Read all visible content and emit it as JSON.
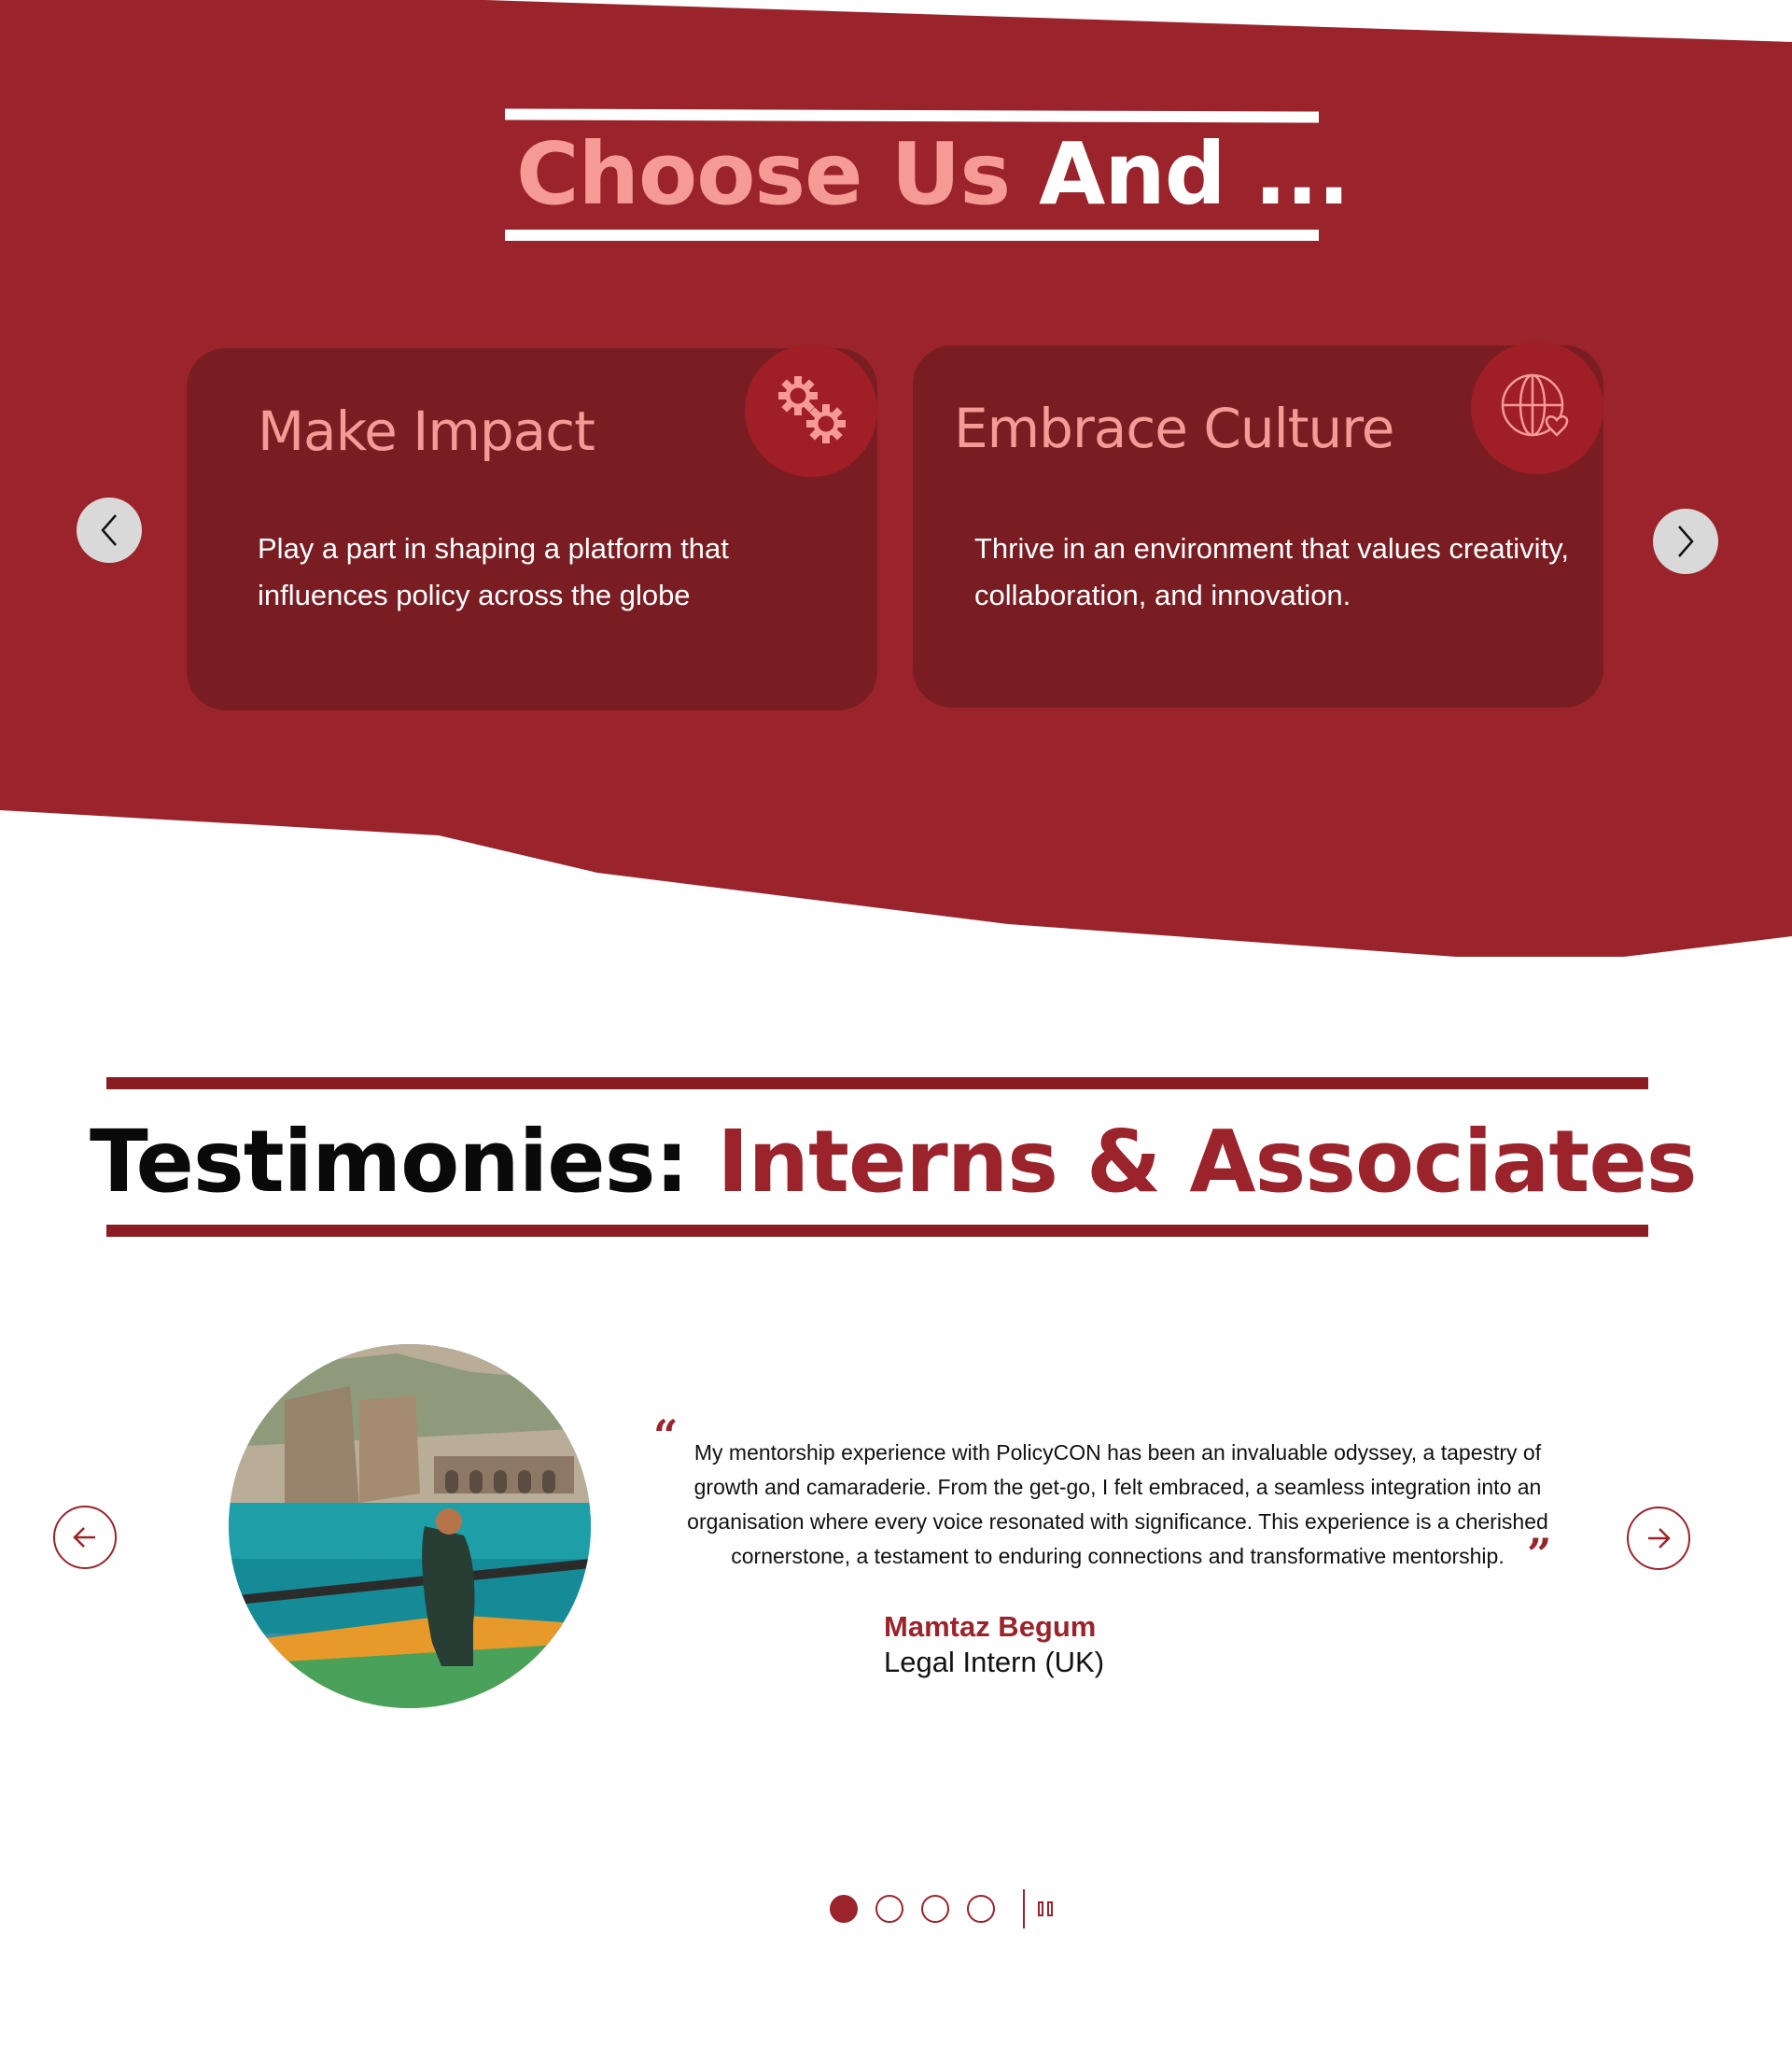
{
  "colors": {
    "brand_red": "#9b232b",
    "card_red": "#7a1d23",
    "badge_red": "#a01e26",
    "accent_pink": "#f59a95"
  },
  "choose": {
    "title_accent": "Choose Us",
    "title_plain": "And ...",
    "prev_icon": "chevron-left-icon",
    "next_icon": "chevron-right-icon",
    "cards": [
      {
        "title": "Make Impact",
        "text": "Play a part in shaping a platform that influences policy across the globe",
        "icon": "gears-icon"
      },
      {
        "title": "Embrace Culture",
        "text": "Thrive in an environment that values creativity, collaboration, and innovation.",
        "icon": "globe-heart-icon"
      }
    ]
  },
  "testimonies": {
    "heading_dark": "Testimonies:",
    "heading_red": "Interns & Associates",
    "quote": "My mentorship experience with PolicyCON has been an invaluable odyssey, a tapestry of growth and camaraderie. From the get-go, I felt embraced, a seamless integration into an organisation where every voice resonated with significance. This experience is a cherished cornerstone, a testament to enduring connections and transformative mentorship.",
    "open_quote": "“",
    "close_quote": "”",
    "name": "Mamtaz Begum",
    "role": "Legal Intern (UK)",
    "slides_total": 4,
    "active_slide": 1
  }
}
